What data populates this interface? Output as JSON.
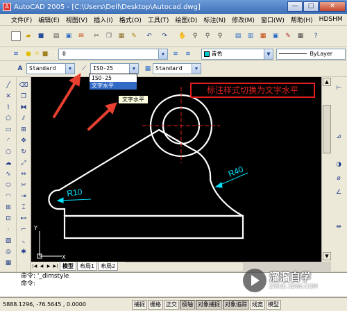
{
  "window": {
    "title": "AutoCAD 2005 - [C:\\Users\\Dell\\Desktop\\Autocad.dwg]",
    "min": "—",
    "max": "□",
    "close": "✕"
  },
  "menu": [
    "文件(F)",
    "编辑(E)",
    "视图(V)",
    "插入(I)",
    "格式(O)",
    "工具(T)",
    "绘图(D)",
    "标注(N)",
    "修改(M)",
    "窗口(W)",
    "帮助(H)",
    "HDSHM"
  ],
  "layer": {
    "value": "0",
    "color_value": "青色",
    "linetype_value": "ByLayer"
  },
  "styles": {
    "text_style": "Standard",
    "dim_style": "ISO-25",
    "table_style": "Standard"
  },
  "dim_dropdown": {
    "options": [
      "ISO-25",
      "文字水平"
    ],
    "selected_index": 1
  },
  "tooltip": "文字水平",
  "annotation": "标注样式切换为文字水平",
  "drawing": {
    "dim_r10": "R10",
    "dim_r40": "R40",
    "ucs_x": "X",
    "ucs_y": "Y"
  },
  "tabs": {
    "model": "模型",
    "layout1": "布局1",
    "layout2": "布局2"
  },
  "command": {
    "line1": "命令: '_dimstyle",
    "line2": "命令:"
  },
  "status": {
    "coords": "5888.1296, -76.5645 , 0.0000",
    "buttons": [
      "捕捉",
      "栅格",
      "正交",
      "极轴",
      "对象捕捉",
      "对象追踪",
      "线宽",
      "模型"
    ]
  },
  "watermark": {
    "name": "溜溜自学",
    "url": "ZIXUE.3D66.COM"
  },
  "colors": {
    "annot_red": "#e02020",
    "dim_cyan": "#00e5ff",
    "center_red": "#e02020",
    "highlight": "#316ac5"
  }
}
